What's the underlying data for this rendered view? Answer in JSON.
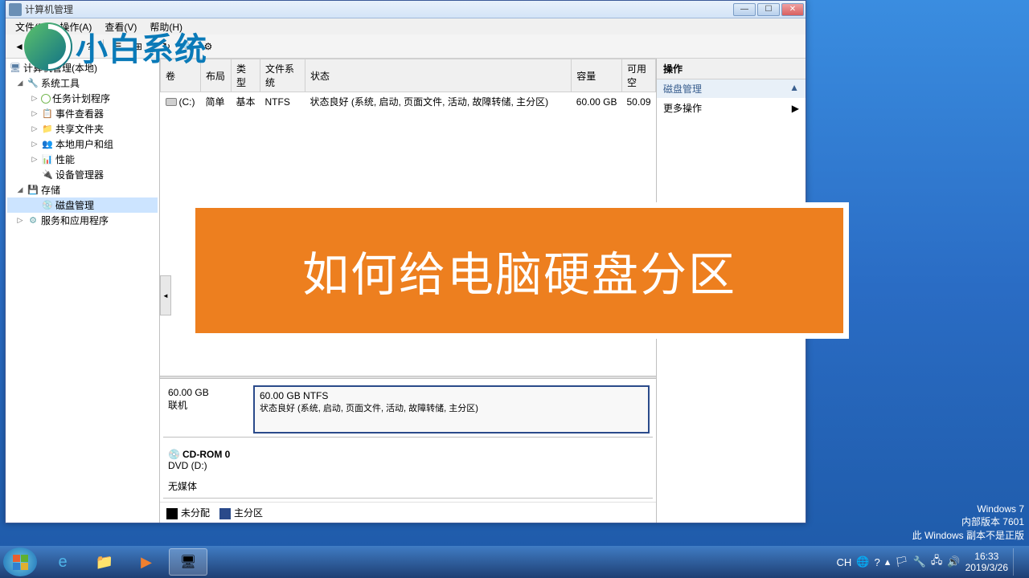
{
  "window": {
    "title": "计算机管理"
  },
  "menubar": [
    "文件(F)",
    "操作(A)",
    "查看(V)",
    "帮助(H)"
  ],
  "watermark_logo_text": "小白系统",
  "tree": {
    "root": "计算机管理(本地)",
    "system_tools": "系统工具",
    "task_scheduler": "任务计划程序",
    "event_viewer": "事件查看器",
    "shared_folders": "共享文件夹",
    "local_users": "本地用户和组",
    "performance": "性能",
    "device_manager": "设备管理器",
    "storage": "存储",
    "disk_management": "磁盘管理",
    "services_apps": "服务和应用程序"
  },
  "volume_table": {
    "headers": {
      "volume": "卷",
      "layout": "布局",
      "type": "类型",
      "filesystem": "文件系统",
      "status": "状态",
      "capacity": "容量",
      "free": "可用空"
    },
    "rows": [
      {
        "volume": "(C:)",
        "layout": "简单",
        "type": "基本",
        "filesystem": "NTFS",
        "status": "状态良好 (系统, 启动, 页面文件, 活动, 故障转储, 主分区)",
        "capacity": "60.00 GB",
        "free": "50.09"
      }
    ]
  },
  "disks": [
    {
      "capacity": "60.00 GB",
      "online": "联机",
      "vol_size_fs": "60.00 GB NTFS",
      "vol_status": "状态良好 (系统, 启动, 页面文件, 活动, 故障转储, 主分区)"
    }
  ],
  "cdrom": {
    "name": "CD-ROM 0",
    "dev": "DVD (D:)",
    "media": "无媒体"
  },
  "legend": {
    "unallocated": "未分配",
    "primary": "主分区"
  },
  "actions": {
    "header": "操作",
    "section": "磁盘管理",
    "more": "更多操作"
  },
  "overlay": {
    "text": "如何给电脑硬盘分区"
  },
  "desktop_watermark": {
    "line1": "Windows 7",
    "line2": "内部版本 7601",
    "line3": "此 Windows 副本不是正版"
  },
  "tray": {
    "ime": "CH",
    "time": "16:33",
    "date": "2019/3/26"
  }
}
